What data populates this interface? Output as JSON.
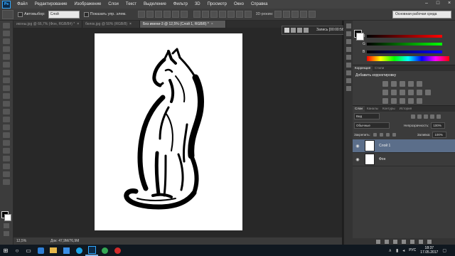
{
  "menubar": {
    "logo": "Ps",
    "items": [
      "Файл",
      "Редактирование",
      "Изображение",
      "Слои",
      "Текст",
      "Выделение",
      "Фильтр",
      "3D",
      "Просмотр",
      "Окно",
      "Справка"
    ]
  },
  "options": {
    "autoselect_label": "Автовыбор:",
    "autoselect_value": "Слой",
    "show_controls_label": "Показать упр. элем.",
    "mode_3d_label": "3D-режим:",
    "workspace": "Основная рабочая среда"
  },
  "tabs": [
    {
      "label": "иконы.jpg @ 66,7% (Фон, RGB/8#) *"
    },
    {
      "label": "белок.jpg @ 50% (RGB/8)"
    },
    {
      "label": "Без имени-3 @ 12,5% (Слой 1, RGB/8) *"
    }
  ],
  "actions": {
    "record_label": "Запись [00:00:56]"
  },
  "status": {
    "zoom": "12,5%",
    "doc": "Док: 47,9M/76,9M"
  },
  "color_panel": {
    "slider_labels": [
      "R",
      "G",
      "B"
    ],
    "values": [
      0,
      0,
      0
    ]
  },
  "adjustments": {
    "tabs": [
      "Коррекция",
      "Стили"
    ],
    "title": "Добавить корректировку"
  },
  "layers": {
    "tabs": [
      "Слои",
      "Каналы",
      "Контуры",
      "История"
    ],
    "filter_label": "Вид",
    "blend_mode": "Обычные",
    "opacity_label": "Непрозрачность:",
    "opacity_value": "100%",
    "lock_label": "Закрепить:",
    "fill_label": "Заливка:",
    "fill_value": "100%",
    "items": [
      {
        "name": "Слой 1"
      },
      {
        "name": "Фон"
      }
    ]
  },
  "taskbar": {
    "time": "18:37",
    "date": "17.05.2017",
    "lang": "РУС"
  },
  "colors": {
    "accent_ps": "#31a8ff",
    "layer_selected": "#5b6e8a",
    "record_red": "#d12a2a"
  }
}
